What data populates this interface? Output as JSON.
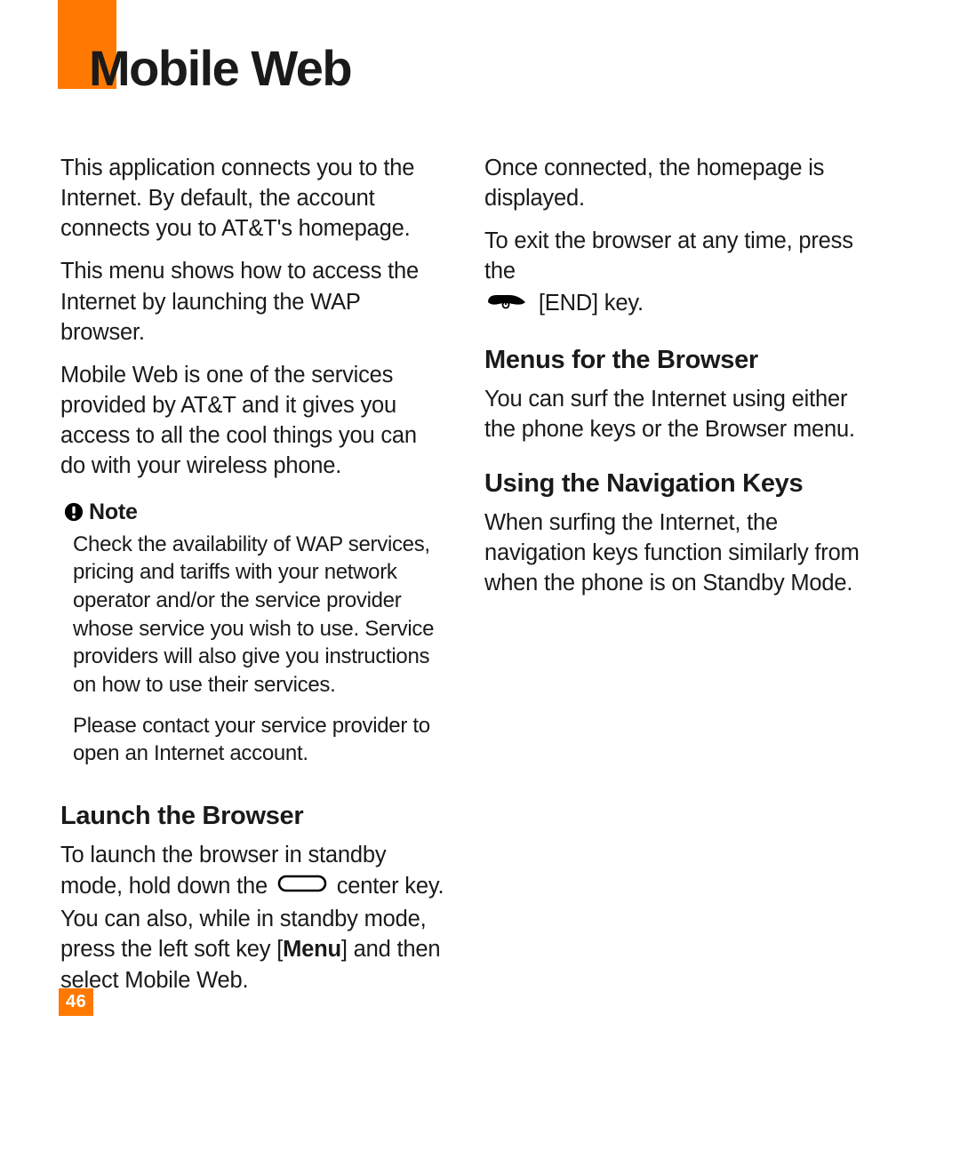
{
  "title": "Mobile Web",
  "page_number": "46",
  "left": {
    "p1": "This application connects you to the Internet. By default, the account connects you to AT&T's homepage.",
    "p2": "This menu shows how to access the Internet by launching the WAP browser.",
    "p3": "Mobile Web is one of the services provided by AT&T and it gives you access to all the cool things you can do with your wireless phone.",
    "note_label": "Note",
    "note_p1": "Check the availability of WAP services, pricing and tariffs with your network operator and/or the service provider whose service you wish to use. Service providers will also give you instructions on how to use their services.",
    "note_p2": "Please contact your service provider to open an Internet account.",
    "h_launch": "Launch the Browser",
    "launch_pre": "To launch the browser in standby mode, hold down the ",
    "launch_mid": " center key. You can also, while in standby mode, press the left soft key [",
    "launch_menu": "Menu",
    "launch_post": "] and then select Mobile Web."
  },
  "right": {
    "p1": "Once connected, the homepage is displayed.",
    "p2_pre": "To exit the browser at any time, press the ",
    "p2_post": " [END] key.",
    "h_menus": "Menus for the Browser",
    "menus_p": "You can surf the Internet using either the phone keys or the Browser menu.",
    "h_nav": "Using the Navigation Keys",
    "nav_p": "When surfing the Internet, the navigation keys function similarly from when the phone is on Standby Mode."
  }
}
